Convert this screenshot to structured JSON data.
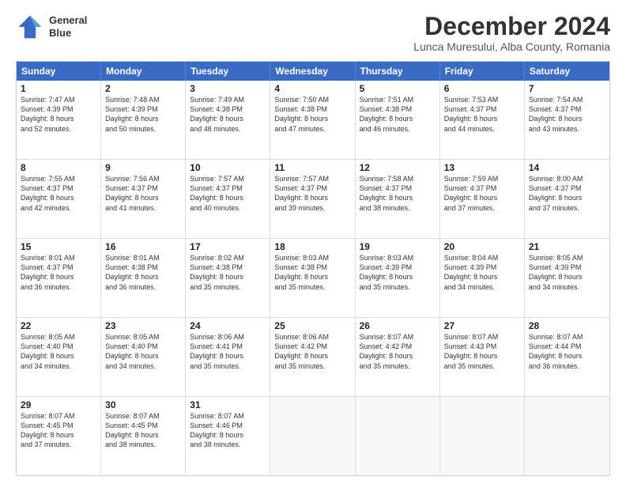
{
  "header": {
    "logo_line1": "General",
    "logo_line2": "Blue",
    "month_title": "December 2024",
    "location": "Lunca Muresului, Alba County, Romania"
  },
  "weekdays": [
    "Sunday",
    "Monday",
    "Tuesday",
    "Wednesday",
    "Thursday",
    "Friday",
    "Saturday"
  ],
  "rows": [
    [
      {
        "day": "",
        "lines": [],
        "empty": true
      },
      {
        "day": "2",
        "lines": [
          "Sunrise: 7:48 AM",
          "Sunset: 4:39 PM",
          "Daylight: 8 hours",
          "and 50 minutes."
        ]
      },
      {
        "day": "3",
        "lines": [
          "Sunrise: 7:49 AM",
          "Sunset: 4:38 PM",
          "Daylight: 8 hours",
          "and 48 minutes."
        ]
      },
      {
        "day": "4",
        "lines": [
          "Sunrise: 7:50 AM",
          "Sunset: 4:38 PM",
          "Daylight: 8 hours",
          "and 47 minutes."
        ]
      },
      {
        "day": "5",
        "lines": [
          "Sunrise: 7:51 AM",
          "Sunset: 4:38 PM",
          "Daylight: 8 hours",
          "and 46 minutes."
        ]
      },
      {
        "day": "6",
        "lines": [
          "Sunrise: 7:53 AM",
          "Sunset: 4:37 PM",
          "Daylight: 8 hours",
          "and 44 minutes."
        ]
      },
      {
        "day": "7",
        "lines": [
          "Sunrise: 7:54 AM",
          "Sunset: 4:37 PM",
          "Daylight: 8 hours",
          "and 43 minutes."
        ]
      }
    ],
    [
      {
        "day": "1",
        "lines": [
          "Sunrise: 7:47 AM",
          "Sunset: 4:39 PM",
          "Daylight: 8 hours",
          "and 52 minutes."
        ],
        "first_row_offset": true
      },
      {
        "day": "",
        "lines": [],
        "empty": true
      },
      {
        "day": "",
        "lines": [],
        "empty": true
      },
      {
        "day": "",
        "lines": [],
        "empty": true
      },
      {
        "day": "",
        "lines": [],
        "empty": true
      },
      {
        "day": "",
        "lines": [],
        "empty": true
      },
      {
        "day": "",
        "lines": [],
        "empty": true
      }
    ],
    [
      {
        "day": "8",
        "lines": [
          "Sunrise: 7:55 AM",
          "Sunset: 4:37 PM",
          "Daylight: 8 hours",
          "and 42 minutes."
        ]
      },
      {
        "day": "9",
        "lines": [
          "Sunrise: 7:56 AM",
          "Sunset: 4:37 PM",
          "Daylight: 8 hours",
          "and 41 minutes."
        ]
      },
      {
        "day": "10",
        "lines": [
          "Sunrise: 7:57 AM",
          "Sunset: 4:37 PM",
          "Daylight: 8 hours",
          "and 40 minutes."
        ]
      },
      {
        "day": "11",
        "lines": [
          "Sunrise: 7:57 AM",
          "Sunset: 4:37 PM",
          "Daylight: 8 hours",
          "and 39 minutes."
        ]
      },
      {
        "day": "12",
        "lines": [
          "Sunrise: 7:58 AM",
          "Sunset: 4:37 PM",
          "Daylight: 8 hours",
          "and 38 minutes."
        ]
      },
      {
        "day": "13",
        "lines": [
          "Sunrise: 7:59 AM",
          "Sunset: 4:37 PM",
          "Daylight: 8 hours",
          "and 37 minutes."
        ]
      },
      {
        "day": "14",
        "lines": [
          "Sunrise: 8:00 AM",
          "Sunset: 4:37 PM",
          "Daylight: 8 hours",
          "and 37 minutes."
        ]
      }
    ],
    [
      {
        "day": "15",
        "lines": [
          "Sunrise: 8:01 AM",
          "Sunset: 4:37 PM",
          "Daylight: 8 hours",
          "and 36 minutes."
        ]
      },
      {
        "day": "16",
        "lines": [
          "Sunrise: 8:01 AM",
          "Sunset: 4:38 PM",
          "Daylight: 8 hours",
          "and 36 minutes."
        ]
      },
      {
        "day": "17",
        "lines": [
          "Sunrise: 8:02 AM",
          "Sunset: 4:38 PM",
          "Daylight: 8 hours",
          "and 35 minutes."
        ]
      },
      {
        "day": "18",
        "lines": [
          "Sunrise: 8:03 AM",
          "Sunset: 4:38 PM",
          "Daylight: 8 hours",
          "and 35 minutes."
        ]
      },
      {
        "day": "19",
        "lines": [
          "Sunrise: 8:03 AM",
          "Sunset: 4:39 PM",
          "Daylight: 8 hours",
          "and 35 minutes."
        ]
      },
      {
        "day": "20",
        "lines": [
          "Sunrise: 8:04 AM",
          "Sunset: 4:39 PM",
          "Daylight: 8 hours",
          "and 34 minutes."
        ]
      },
      {
        "day": "21",
        "lines": [
          "Sunrise: 8:05 AM",
          "Sunset: 4:39 PM",
          "Daylight: 8 hours",
          "and 34 minutes."
        ]
      }
    ],
    [
      {
        "day": "22",
        "lines": [
          "Sunrise: 8:05 AM",
          "Sunset: 4:40 PM",
          "Daylight: 8 hours",
          "and 34 minutes."
        ]
      },
      {
        "day": "23",
        "lines": [
          "Sunrise: 8:05 AM",
          "Sunset: 4:40 PM",
          "Daylight: 8 hours",
          "and 34 minutes."
        ]
      },
      {
        "day": "24",
        "lines": [
          "Sunrise: 8:06 AM",
          "Sunset: 4:41 PM",
          "Daylight: 8 hours",
          "and 35 minutes."
        ]
      },
      {
        "day": "25",
        "lines": [
          "Sunrise: 8:06 AM",
          "Sunset: 4:42 PM",
          "Daylight: 8 hours",
          "and 35 minutes."
        ]
      },
      {
        "day": "26",
        "lines": [
          "Sunrise: 8:07 AM",
          "Sunset: 4:42 PM",
          "Daylight: 8 hours",
          "and 35 minutes."
        ]
      },
      {
        "day": "27",
        "lines": [
          "Sunrise: 8:07 AM",
          "Sunset: 4:43 PM",
          "Daylight: 8 hours",
          "and 35 minutes."
        ]
      },
      {
        "day": "28",
        "lines": [
          "Sunrise: 8:07 AM",
          "Sunset: 4:44 PM",
          "Daylight: 8 hours",
          "and 36 minutes."
        ]
      }
    ],
    [
      {
        "day": "29",
        "lines": [
          "Sunrise: 8:07 AM",
          "Sunset: 4:45 PM",
          "Daylight: 8 hours",
          "and 37 minutes."
        ]
      },
      {
        "day": "30",
        "lines": [
          "Sunrise: 8:07 AM",
          "Sunset: 4:45 PM",
          "Daylight: 8 hours",
          "and 38 minutes."
        ]
      },
      {
        "day": "31",
        "lines": [
          "Sunrise: 8:07 AM",
          "Sunset: 4:46 PM",
          "Daylight: 8 hours",
          "and 38 minutes."
        ]
      },
      {
        "day": "",
        "lines": [],
        "empty": true
      },
      {
        "day": "",
        "lines": [],
        "empty": true
      },
      {
        "day": "",
        "lines": [],
        "empty": true
      },
      {
        "day": "",
        "lines": [],
        "empty": true
      }
    ]
  ],
  "actual_rows": [
    {
      "cells": [
        {
          "day": "1",
          "lines": [
            "Sunrise: 7:47 AM",
            "Sunset: 4:39 PM",
            "Daylight: 8 hours",
            "and 52 minutes."
          ]
        },
        {
          "day": "2",
          "lines": [
            "Sunrise: 7:48 AM",
            "Sunset: 4:39 PM",
            "Daylight: 8 hours",
            "and 50 minutes."
          ]
        },
        {
          "day": "3",
          "lines": [
            "Sunrise: 7:49 AM",
            "Sunset: 4:38 PM",
            "Daylight: 8 hours",
            "and 48 minutes."
          ]
        },
        {
          "day": "4",
          "lines": [
            "Sunrise: 7:50 AM",
            "Sunset: 4:38 PM",
            "Daylight: 8 hours",
            "and 47 minutes."
          ]
        },
        {
          "day": "5",
          "lines": [
            "Sunrise: 7:51 AM",
            "Sunset: 4:38 PM",
            "Daylight: 8 hours",
            "and 46 minutes."
          ]
        },
        {
          "day": "6",
          "lines": [
            "Sunrise: 7:53 AM",
            "Sunset: 4:37 PM",
            "Daylight: 8 hours",
            "and 44 minutes."
          ]
        },
        {
          "day": "7",
          "lines": [
            "Sunrise: 7:54 AM",
            "Sunset: 4:37 PM",
            "Daylight: 8 hours",
            "and 43 minutes."
          ]
        }
      ]
    },
    {
      "cells": [
        {
          "day": "8",
          "lines": [
            "Sunrise: 7:55 AM",
            "Sunset: 4:37 PM",
            "Daylight: 8 hours",
            "and 42 minutes."
          ]
        },
        {
          "day": "9",
          "lines": [
            "Sunrise: 7:56 AM",
            "Sunset: 4:37 PM",
            "Daylight: 8 hours",
            "and 41 minutes."
          ]
        },
        {
          "day": "10",
          "lines": [
            "Sunrise: 7:57 AM",
            "Sunset: 4:37 PM",
            "Daylight: 8 hours",
            "and 40 minutes."
          ]
        },
        {
          "day": "11",
          "lines": [
            "Sunrise: 7:57 AM",
            "Sunset: 4:37 PM",
            "Daylight: 8 hours",
            "and 39 minutes."
          ]
        },
        {
          "day": "12",
          "lines": [
            "Sunrise: 7:58 AM",
            "Sunset: 4:37 PM",
            "Daylight: 8 hours",
            "and 38 minutes."
          ]
        },
        {
          "day": "13",
          "lines": [
            "Sunrise: 7:59 AM",
            "Sunset: 4:37 PM",
            "Daylight: 8 hours",
            "and 37 minutes."
          ]
        },
        {
          "day": "14",
          "lines": [
            "Sunrise: 8:00 AM",
            "Sunset: 4:37 PM",
            "Daylight: 8 hours",
            "and 37 minutes."
          ]
        }
      ]
    },
    {
      "cells": [
        {
          "day": "15",
          "lines": [
            "Sunrise: 8:01 AM",
            "Sunset: 4:37 PM",
            "Daylight: 8 hours",
            "and 36 minutes."
          ]
        },
        {
          "day": "16",
          "lines": [
            "Sunrise: 8:01 AM",
            "Sunset: 4:38 PM",
            "Daylight: 8 hours",
            "and 36 minutes."
          ]
        },
        {
          "day": "17",
          "lines": [
            "Sunrise: 8:02 AM",
            "Sunset: 4:38 PM",
            "Daylight: 8 hours",
            "and 35 minutes."
          ]
        },
        {
          "day": "18",
          "lines": [
            "Sunrise: 8:03 AM",
            "Sunset: 4:38 PM",
            "Daylight: 8 hours",
            "and 35 minutes."
          ]
        },
        {
          "day": "19",
          "lines": [
            "Sunrise: 8:03 AM",
            "Sunset: 4:39 PM",
            "Daylight: 8 hours",
            "and 35 minutes."
          ]
        },
        {
          "day": "20",
          "lines": [
            "Sunrise: 8:04 AM",
            "Sunset: 4:39 PM",
            "Daylight: 8 hours",
            "and 34 minutes."
          ]
        },
        {
          "day": "21",
          "lines": [
            "Sunrise: 8:05 AM",
            "Sunset: 4:39 PM",
            "Daylight: 8 hours",
            "and 34 minutes."
          ]
        }
      ]
    },
    {
      "cells": [
        {
          "day": "22",
          "lines": [
            "Sunrise: 8:05 AM",
            "Sunset: 4:40 PM",
            "Daylight: 8 hours",
            "and 34 minutes."
          ]
        },
        {
          "day": "23",
          "lines": [
            "Sunrise: 8:05 AM",
            "Sunset: 4:40 PM",
            "Daylight: 8 hours",
            "and 34 minutes."
          ]
        },
        {
          "day": "24",
          "lines": [
            "Sunrise: 8:06 AM",
            "Sunset: 4:41 PM",
            "Daylight: 8 hours",
            "and 35 minutes."
          ]
        },
        {
          "day": "25",
          "lines": [
            "Sunrise: 8:06 AM",
            "Sunset: 4:42 PM",
            "Daylight: 8 hours",
            "and 35 minutes."
          ]
        },
        {
          "day": "26",
          "lines": [
            "Sunrise: 8:07 AM",
            "Sunset: 4:42 PM",
            "Daylight: 8 hours",
            "and 35 minutes."
          ]
        },
        {
          "day": "27",
          "lines": [
            "Sunrise: 8:07 AM",
            "Sunset: 4:43 PM",
            "Daylight: 8 hours",
            "and 35 minutes."
          ]
        },
        {
          "day": "28",
          "lines": [
            "Sunrise: 8:07 AM",
            "Sunset: 4:44 PM",
            "Daylight: 8 hours",
            "and 36 minutes."
          ]
        }
      ]
    },
    {
      "cells": [
        {
          "day": "29",
          "lines": [
            "Sunrise: 8:07 AM",
            "Sunset: 4:45 PM",
            "Daylight: 8 hours",
            "and 37 minutes."
          ]
        },
        {
          "day": "30",
          "lines": [
            "Sunrise: 8:07 AM",
            "Sunset: 4:45 PM",
            "Daylight: 8 hours",
            "and 38 minutes."
          ]
        },
        {
          "day": "31",
          "lines": [
            "Sunrise: 8:07 AM",
            "Sunset: 4:46 PM",
            "Daylight: 8 hours",
            "and 38 minutes."
          ]
        },
        {
          "day": "",
          "lines": [],
          "empty": true
        },
        {
          "day": "",
          "lines": [],
          "empty": true
        },
        {
          "day": "",
          "lines": [],
          "empty": true
        },
        {
          "day": "",
          "lines": [],
          "empty": true
        }
      ]
    }
  ]
}
